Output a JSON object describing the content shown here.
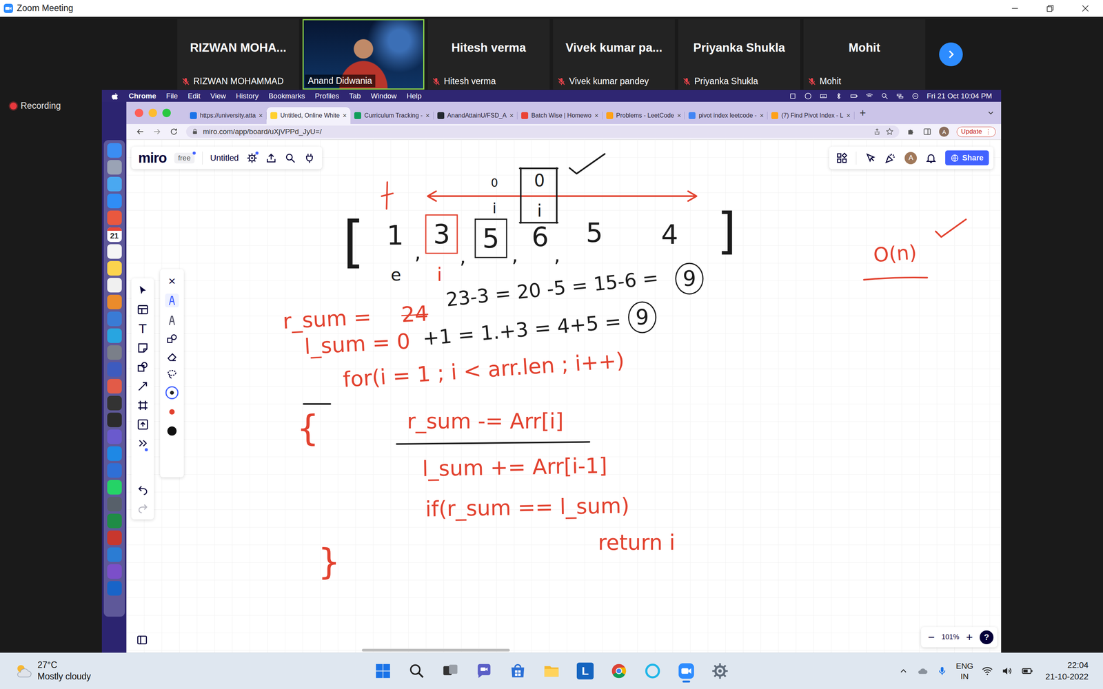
{
  "zoom": {
    "title": "Zoom Meeting",
    "recording": "Recording",
    "participants": [
      {
        "name": "RIZWAN MOHA...",
        "label": "RIZWAN MOHAMMAD",
        "muted": true,
        "video": false,
        "speaking": false
      },
      {
        "label": "Anand Didwania",
        "muted": false,
        "video": true,
        "speaking": true
      },
      {
        "name": "Hitesh verma",
        "label": "Hitesh verma",
        "muted": true,
        "video": false,
        "speaking": false
      },
      {
        "name": "Vivek kumar pa...",
        "label": "Vivek kumar pandey",
        "muted": true,
        "video": false,
        "speaking": false
      },
      {
        "name": "Priyanka Shukla",
        "label": "Priyanka Shukla",
        "muted": true,
        "video": false,
        "speaking": false
      },
      {
        "name": "Mohit",
        "label": "Mohit",
        "muted": true,
        "video": false,
        "speaking": false
      }
    ]
  },
  "mac_menu": {
    "app": "Chrome",
    "items": [
      "File",
      "Edit",
      "View",
      "History",
      "Bookmarks",
      "Profiles",
      "Tab",
      "Window",
      "Help"
    ],
    "clock": "Fri 21 Oct 10:04 PM"
  },
  "dock": {
    "calendar_day": "21"
  },
  "chrome": {
    "tabs": [
      {
        "label": "https://university.atta",
        "selected": false
      },
      {
        "label": "Untitled, Online White",
        "selected": true
      },
      {
        "label": "Curriculum Tracking -",
        "selected": false
      },
      {
        "label": "AnandAttainU/FSD_A",
        "selected": false
      },
      {
        "label": "Batch Wise | Homewo",
        "selected": false
      },
      {
        "label": "Problems - LeetCode",
        "selected": false
      },
      {
        "label": "pivot index leetcode -",
        "selected": false
      },
      {
        "label": "(7) Find Pivot Index - L",
        "selected": false
      }
    ],
    "tab_close": "×",
    "new_tab": "+",
    "url": "miro.com/app/board/uXjVPPd_JyU=/",
    "profile": "A",
    "update": "Update",
    "menu": "⋮"
  },
  "miro": {
    "logo": "miro",
    "plan": "free",
    "board": "Untitled",
    "profile": "A",
    "share": "Share",
    "text_tool": "T",
    "pen_close": "×",
    "pens": [
      {
        "selected": true
      },
      {
        "selected": false
      }
    ],
    "pen_colors": [
      {
        "color": "#1f1f1f",
        "selected": true
      },
      {
        "color": "#e2412e",
        "selected": false
      },
      {
        "color": "#111111",
        "selected": false
      }
    ],
    "zoom_out": "−",
    "zoom_level": "101%",
    "zoom_in": "+",
    "help": "?"
  },
  "whiteboard": {
    "marks": [
      {
        "text": "[",
        "color": "#1b1b1b",
        "kind": "plain"
      },
      {
        "text": "1",
        "color": "#1b1b1b",
        "kind": "plain"
      },
      {
        "text": ",",
        "color": "#1b1b1b",
        "kind": "plain"
      },
      {
        "text": "3",
        "color": "#1b1b1b",
        "kind": "boxed",
        "frame_color": "#e2412e"
      },
      {
        "text": ",",
        "color": "#1b1b1b",
        "kind": "plain"
      },
      {
        "text": "5",
        "color": "#1b1b1b",
        "kind": "boxed",
        "frame_color": "#1b1b1b"
      },
      {
        "text": ",",
        "color": "#1b1b1b",
        "kind": "plain"
      },
      {
        "text": "6",
        "color": "#1b1b1b",
        "kind": "plain"
      },
      {
        "text": ",",
        "color": "#1b1b1b",
        "kind": "plain"
      },
      {
        "text": "5",
        "color": "#1b1b1b",
        "kind": "plain"
      },
      {
        "text": "4",
        "color": "#1b1b1b",
        "kind": "plain"
      },
      {
        "text": "]",
        "color": "#1b1b1b",
        "kind": "plain"
      },
      {
        "text": "0",
        "color": "#1b1b1b",
        "kind": "plain"
      },
      {
        "text": "i",
        "color": "#1b1b1b",
        "kind": "plain"
      },
      {
        "text": "0",
        "color": "#1b1b1b",
        "kind": "plain"
      },
      {
        "text": "i",
        "color": "#1b1b1b",
        "kind": "plain"
      },
      {
        "text": "e",
        "color": "#1b1b1b",
        "kind": "plain"
      },
      {
        "text": "i",
        "color": "#e2412e",
        "kind": "plain"
      },
      {
        "text": "r_sum =",
        "color": "#e2412e",
        "kind": "plain"
      },
      {
        "text": "24",
        "color": "#e2412e",
        "kind": "struck"
      },
      {
        "text": "23-3 = 20 -5 = 15-6 =",
        "color": "#1b1b1b",
        "kind": "plain"
      },
      {
        "text": "9",
        "color": "#1b1b1b",
        "kind": "circled",
        "frame_color": "#1b1b1b"
      },
      {
        "text": "l_sum = 0",
        "color": "#e2412e",
        "kind": "plain"
      },
      {
        "text": "+1 = 1.+3 = 4+5 =",
        "color": "#1b1b1b",
        "kind": "plain"
      },
      {
        "text": "9",
        "color": "#1b1b1b",
        "kind": "circled",
        "frame_color": "#1b1b1b"
      },
      {
        "text": "for(i = 1 ; i < arr.len ; i++)",
        "color": "#e2412e",
        "kind": "plain"
      },
      {
        "text": "{",
        "color": "#e2412e",
        "kind": "plain"
      },
      {
        "text": "r_sum -= Arr[i]",
        "color": "#e2412e",
        "kind": "plain"
      },
      {
        "text": "l_sum += Arr[i-1]",
        "color": "#e2412e",
        "kind": "plain"
      },
      {
        "text": "if(r_sum == l_sum)",
        "color": "#e2412e",
        "kind": "plain"
      },
      {
        "text": "return i",
        "color": "#e2412e",
        "kind": "plain"
      },
      {
        "text": "}",
        "color": "#e2412e",
        "kind": "plain"
      },
      {
        "text": "O(n)",
        "color": "#e2412e",
        "kind": "plain"
      }
    ]
  },
  "taskbar": {
    "temperature": "27°C",
    "weather": "Mostly cloudy",
    "apps": [
      {
        "kind": "windows",
        "selected": false
      },
      {
        "kind": "search",
        "selected": false
      },
      {
        "kind": "taskview",
        "selected": false
      },
      {
        "kind": "chat",
        "selected": false
      },
      {
        "kind": "store",
        "selected": false
      },
      {
        "kind": "explorer",
        "selected": false
      },
      {
        "kind": "letter",
        "glyph": "L",
        "selected": false
      },
      {
        "kind": "chrome",
        "selected": false
      },
      {
        "kind": "ring",
        "selected": false
      },
      {
        "kind": "zoom",
        "selected": true
      },
      {
        "kind": "settings",
        "selected": false
      }
    ],
    "language": "ENG",
    "region": "IN",
    "time": "22:04",
    "date": "21-10-2022"
  }
}
